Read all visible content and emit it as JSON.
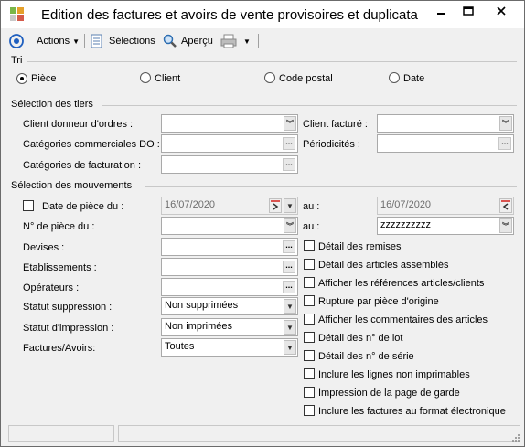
{
  "window": {
    "title": "Edition des factures et avoirs de vente provisoires et duplicata"
  },
  "toolbar": {
    "actions": "Actions",
    "selections": "Sélections",
    "apercu": "Aperçu"
  },
  "tri": {
    "title": "Tri",
    "options": [
      "Pièce",
      "Client",
      "Code postal",
      "Date"
    ],
    "selected": "Pièce"
  },
  "tiers": {
    "title": "Sélection des tiers",
    "client_donneur": "Client donneur d'ordres :",
    "client_facture": "Client facturé :",
    "categories_do": "Catégories commerciales DO :",
    "periodicites": "Périodicités :",
    "categories_fact": "Catégories de facturation :"
  },
  "mouvements": {
    "title": "Sélection des mouvements",
    "date_piece_du": "Date de pièce du :",
    "date_du_value": "16/07/2020",
    "au1": "au :",
    "date_au_value": "16/07/2020",
    "num_piece_du": "N° de pièce du :",
    "au2": "au :",
    "num_au_value": "zzzzzzzzzz",
    "devises": "Devises :",
    "etablissements": "Etablissements :",
    "operateurs": "Opérateurs :",
    "statut_suppression": "Statut suppression :",
    "statut_suppression_value": "Non supprimées",
    "statut_impression": "Statut d'impression :",
    "statut_impression_value": "Non imprimées",
    "factures_avoirs": "Factures/Avoirs:",
    "factures_avoirs_value": "Toutes"
  },
  "options": [
    "Détail des remises",
    "Détail des articles assemblés",
    "Afficher les références articles/clients",
    "Rupture par pièce d'origine",
    "Afficher les commentaires des articles",
    "Détail des n° de lot",
    "Détail des n° de série",
    "Inclure les lignes non imprimables",
    "Impression de la page de garde",
    "Inclure les factures au format électronique"
  ]
}
